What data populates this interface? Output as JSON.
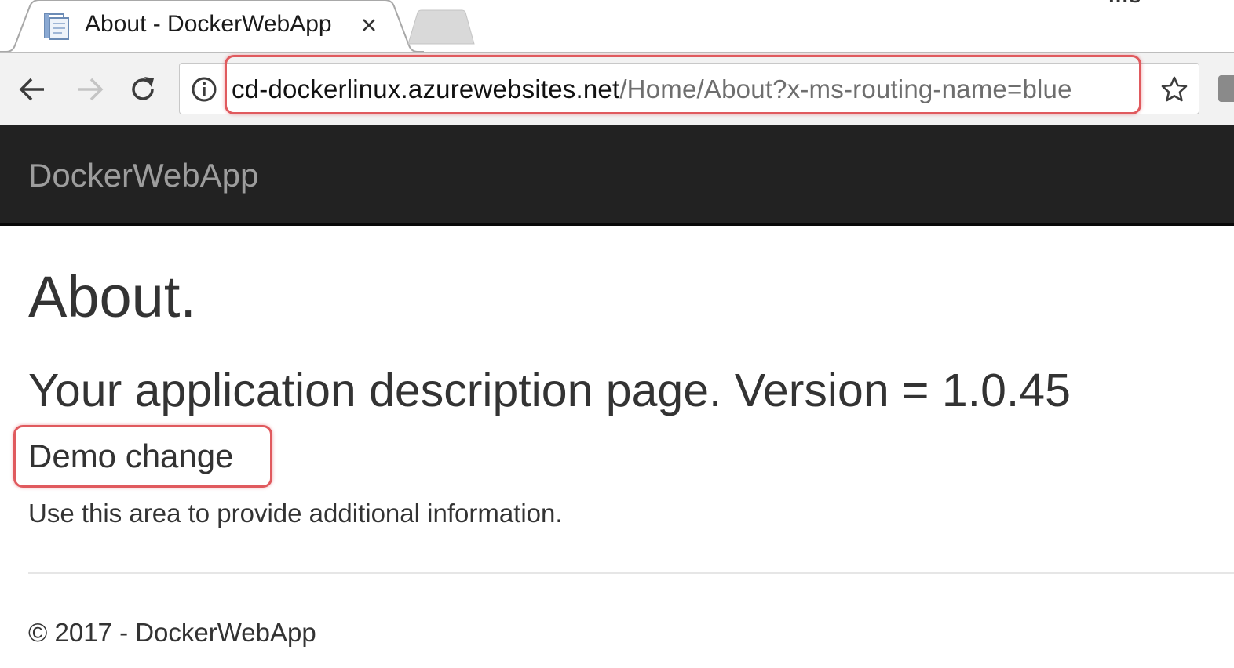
{
  "browser": {
    "tab_title": "About - DockerWebApp",
    "corner_text": "ms",
    "url_host": "cd-dockerlinux.azurewebsites.net",
    "url_path": "/Home/About?x-ms-routing-name=blue",
    "icons": {
      "favicon": "page-icon",
      "close": "close-icon",
      "back": "back-arrow-icon",
      "forward": "forward-arrow-icon",
      "reload": "reload-icon",
      "info": "info-icon",
      "bookmark": "star-icon"
    },
    "highlight_color": "#e05a5e"
  },
  "navbar": {
    "brand": "DockerWebApp",
    "background": "#222222"
  },
  "content": {
    "title": "About.",
    "subtitle": "Your application description page. Version = 1.0.45",
    "demo": "Demo change",
    "info": "Use this area to provide additional information.",
    "footer": "© 2017 - DockerWebApp"
  }
}
